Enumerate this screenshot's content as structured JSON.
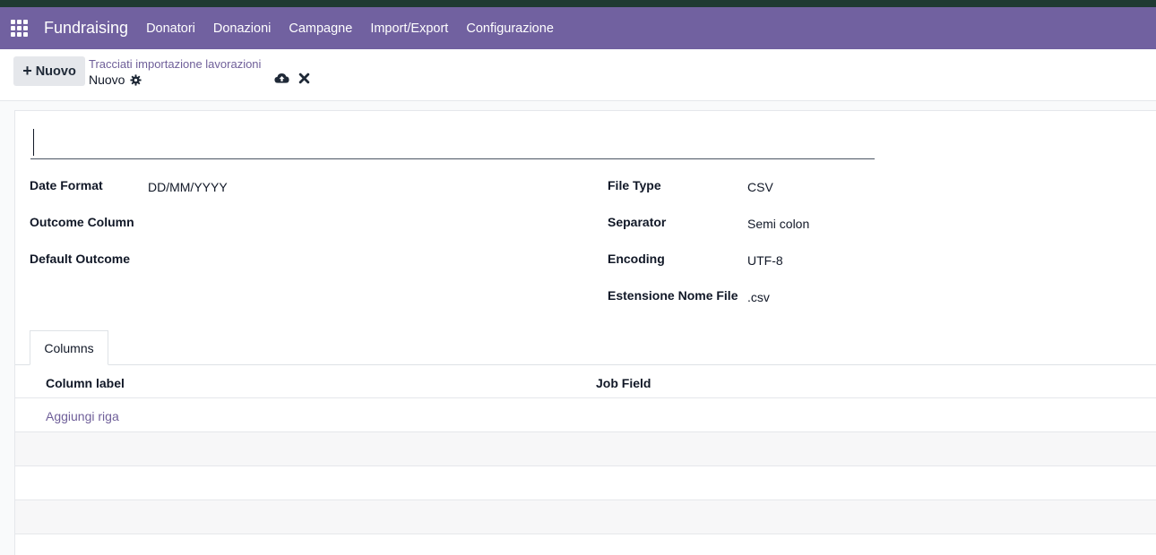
{
  "navbar": {
    "brand": "Fundraising",
    "menu": [
      "Donatori",
      "Donazioni",
      "Campagne",
      "Import/Export",
      "Configurazione"
    ]
  },
  "control": {
    "new_label": "Nuovo",
    "breadcrumb_parent": "Tracciati importazione lavorazioni",
    "breadcrumb_current": "Nuovo"
  },
  "form": {
    "name_value": "",
    "left_fields": [
      {
        "label": "Date Format",
        "value": "DD/MM/YYYY"
      },
      {
        "label": "Outcome Column",
        "value": ""
      },
      {
        "label": "Default Outcome",
        "value": ""
      }
    ],
    "right_fields": [
      {
        "label": "File Type",
        "value": "CSV"
      },
      {
        "label": "Separator",
        "value": "Semi colon"
      },
      {
        "label": "Encoding",
        "value": "UTF-8"
      },
      {
        "label": "Estensione Nome File",
        "value": ".csv"
      }
    ]
  },
  "notebook": {
    "tab_label": "Columns",
    "columns": [
      "Column label",
      "Job Field"
    ],
    "add_line": "Aggiungi riga"
  },
  "colors": {
    "navbar": "#7161a0",
    "link": "#6f5f99"
  }
}
